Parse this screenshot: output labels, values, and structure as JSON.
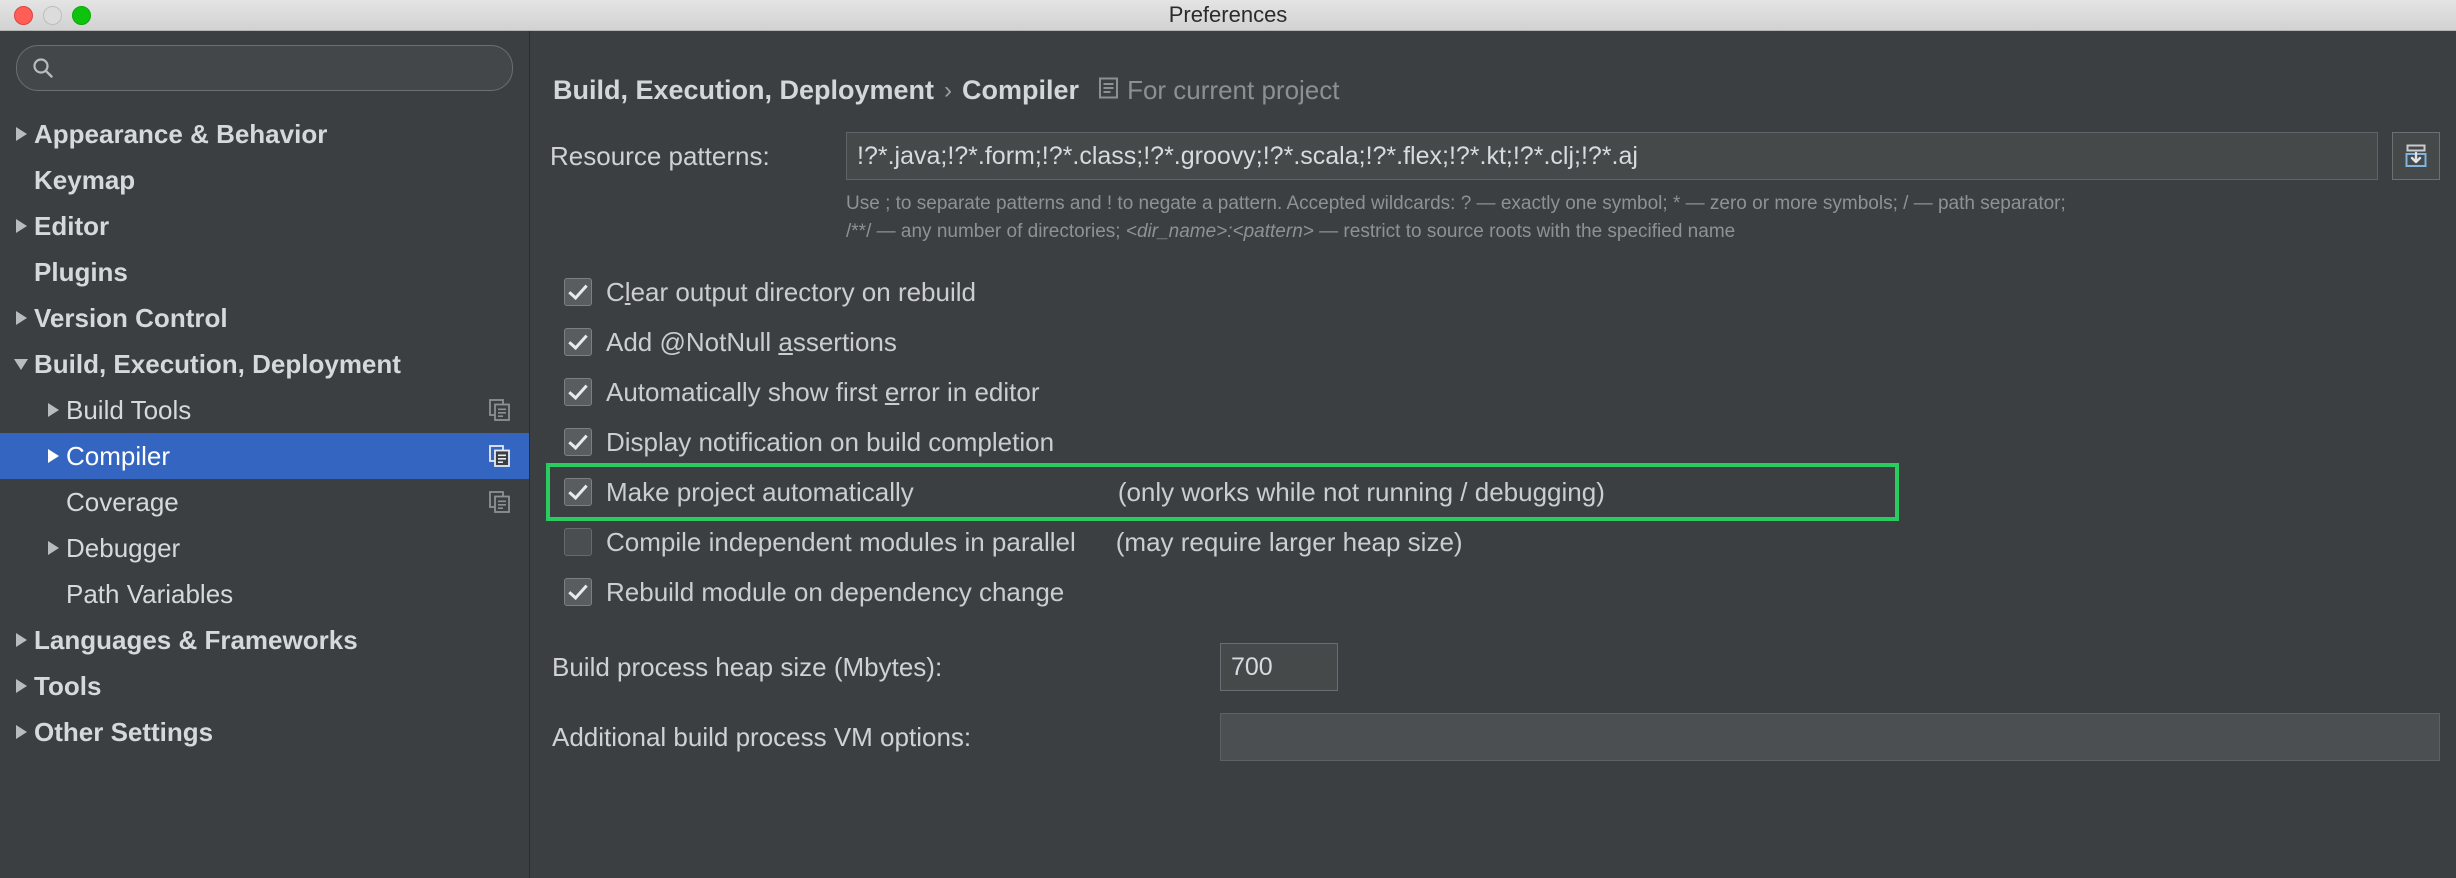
{
  "window": {
    "title": "Preferences",
    "traffic_lights": [
      "close-button",
      "minimize-button",
      "zoom-button"
    ]
  },
  "search": {
    "placeholder": "",
    "value": "",
    "icon": "search-icon"
  },
  "sidebar": {
    "items": [
      {
        "label": "Appearance & Behavior",
        "level": 1,
        "arrow": "right",
        "expanded": false,
        "selected": false,
        "top": true,
        "copy_icon": false
      },
      {
        "label": "Keymap",
        "level": 1,
        "arrow": "none",
        "expanded": false,
        "selected": false,
        "top": true,
        "copy_icon": false
      },
      {
        "label": "Editor",
        "level": 1,
        "arrow": "right",
        "expanded": false,
        "selected": false,
        "top": true,
        "copy_icon": false
      },
      {
        "label": "Plugins",
        "level": 1,
        "arrow": "none",
        "expanded": false,
        "selected": false,
        "top": true,
        "copy_icon": false
      },
      {
        "label": "Version Control",
        "level": 1,
        "arrow": "right",
        "expanded": false,
        "selected": false,
        "top": true,
        "copy_icon": false
      },
      {
        "label": "Build, Execution, Deployment",
        "level": 1,
        "arrow": "down",
        "expanded": true,
        "selected": false,
        "top": true,
        "copy_icon": false
      },
      {
        "label": "Build Tools",
        "level": 2,
        "arrow": "right",
        "expanded": false,
        "selected": false,
        "top": false,
        "copy_icon": true
      },
      {
        "label": "Compiler",
        "level": 2,
        "arrow": "right",
        "expanded": false,
        "selected": true,
        "top": false,
        "copy_icon": true
      },
      {
        "label": "Coverage",
        "level": 2,
        "arrow": "none",
        "expanded": false,
        "selected": false,
        "top": false,
        "copy_icon": true
      },
      {
        "label": "Debugger",
        "level": 2,
        "arrow": "right",
        "expanded": false,
        "selected": false,
        "top": false,
        "copy_icon": false
      },
      {
        "label": "Path Variables",
        "level": 2,
        "arrow": "none",
        "expanded": false,
        "selected": false,
        "top": false,
        "copy_icon": false
      },
      {
        "label": "Languages & Frameworks",
        "level": 1,
        "arrow": "right",
        "expanded": false,
        "selected": false,
        "top": true,
        "copy_icon": false
      },
      {
        "label": "Tools",
        "level": 1,
        "arrow": "right",
        "expanded": false,
        "selected": false,
        "top": true,
        "copy_icon": false
      },
      {
        "label": "Other Settings",
        "level": 1,
        "arrow": "right",
        "expanded": false,
        "selected": false,
        "top": true,
        "copy_icon": false
      }
    ]
  },
  "main": {
    "breadcrumb": {
      "parent": "Build, Execution, Deployment",
      "separator": "›",
      "current": "Compiler",
      "scope_icon": "project-scope-icon",
      "scope_text": "For current project"
    },
    "resource_patterns": {
      "label": "Resource patterns:",
      "value": "!?*.java;!?*.form;!?*.class;!?*.groovy;!?*.scala;!?*.flex;!?*.kt;!?*.clj;!?*.aj",
      "placeholder": "",
      "expand_button_icon": "expand-editor-icon"
    },
    "hint_line1": "Use ; to separate patterns and ! to negate a pattern. Accepted wildcards: ? — exactly one symbol; * — zero or more symbols; / — path separator;",
    "hint_line2_pre": "/**/ — any number of directories; ",
    "hint_line2_italic": "<dir_name>:<pattern>",
    "hint_line2_post": " — restrict to source roots with the specified name",
    "checkboxes": [
      {
        "label_pre": "C",
        "label_mnemonic": "l",
        "label_post": "ear output directory on rebuild",
        "checked": true,
        "disabled": false,
        "note": "",
        "highlighted": false
      },
      {
        "label_pre": "Add @NotNull ",
        "label_mnemonic": "a",
        "label_post": "ssertions",
        "checked": true,
        "disabled": false,
        "note": "",
        "highlighted": false
      },
      {
        "label_pre": "Automatically show first ",
        "label_mnemonic": "e",
        "label_post": "rror in editor",
        "checked": true,
        "disabled": false,
        "note": "",
        "highlighted": false
      },
      {
        "label_pre": "Display notification on build completion",
        "label_mnemonic": "",
        "label_post": "",
        "checked": true,
        "disabled": false,
        "note": "",
        "highlighted": false
      },
      {
        "label_pre": "Make project automatically",
        "label_mnemonic": "",
        "label_post": "",
        "checked": true,
        "disabled": false,
        "note": "(only works while not running / debugging)",
        "highlighted": true
      },
      {
        "label_pre": "Compile independent modules in parallel",
        "label_mnemonic": "",
        "label_post": "",
        "checked": false,
        "disabled": true,
        "note": "(may require larger heap size)",
        "highlighted": false
      },
      {
        "label_pre": "Rebuild module on dependency change",
        "label_mnemonic": "",
        "label_post": "",
        "checked": true,
        "disabled": false,
        "note": "",
        "highlighted": false
      }
    ],
    "heap": {
      "label": "Build process heap size (Mbytes):",
      "value": "700"
    },
    "vm_options": {
      "label": "Additional build process VM options:",
      "value": "",
      "placeholder": ""
    }
  },
  "colors": {
    "window_background": "#3c3f41",
    "selection_blue": "#3465c0",
    "highlight_green": "#29cc5f",
    "text_primary": "#cbced0",
    "text_muted": "#8e9295",
    "titlebar": "#dcdcdc"
  }
}
